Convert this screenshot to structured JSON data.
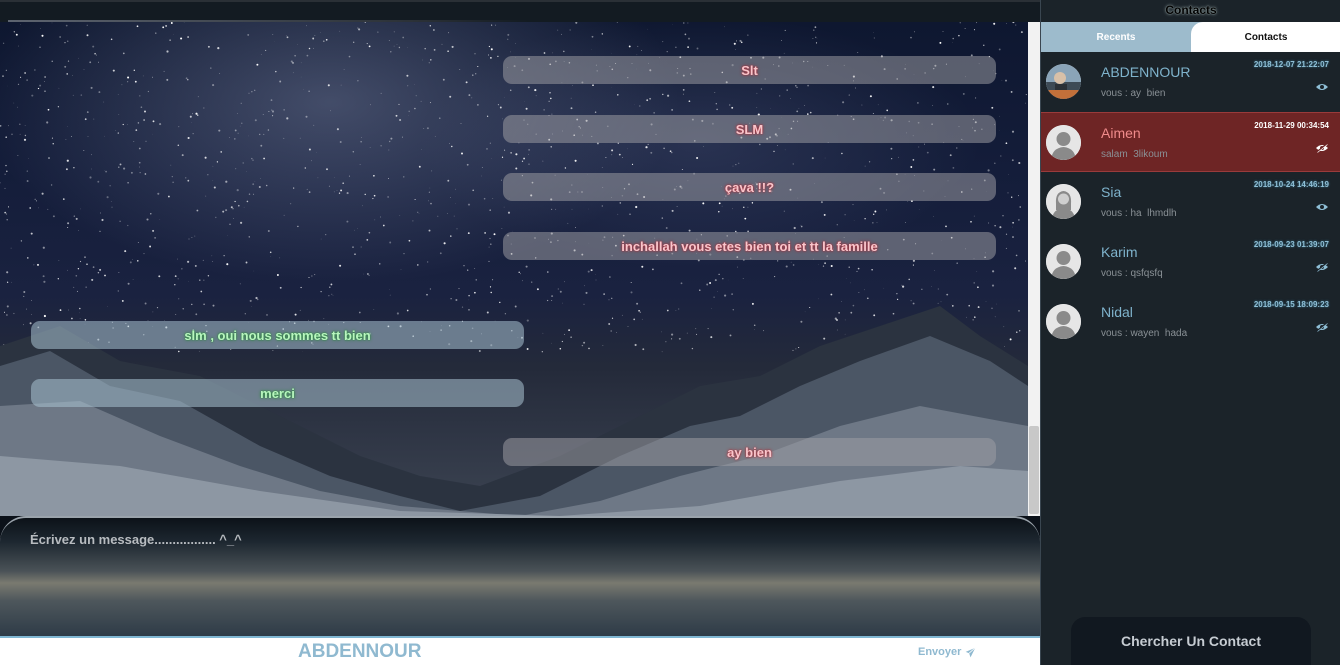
{
  "chat": {
    "messages": [
      {
        "text": "Slt",
        "direction": "sent"
      },
      {
        "text": "SLM",
        "direction": "sent"
      },
      {
        "text": "çava !!?",
        "direction": "sent"
      },
      {
        "text": "inchallah vous etes bien toi et tt la famille",
        "direction": "sent"
      },
      {
        "text": "slm , oui nous sommes tt bien",
        "direction": "received"
      },
      {
        "text": "merci",
        "direction": "received"
      },
      {
        "text": "ay bien",
        "direction": "sent"
      }
    ]
  },
  "composer": {
    "placeholder": "Écrivez un message................. ^_^"
  },
  "footer": {
    "current_contact": "ABDENNOUR",
    "send_label": "Envoyer",
    "send_icon": "paper-plane-icon"
  },
  "sidebar": {
    "title": "Contacts",
    "tabs": [
      {
        "label": "Recents"
      },
      {
        "label": "Contacts"
      }
    ],
    "active_tab": "Contacts",
    "contacts": [
      {
        "name": "ABDENNOUR",
        "preview": "vous : ay  bien",
        "date": "2018-12-07 21:22:07",
        "avatar": "photo-avatar",
        "seen": true,
        "active": false
      },
      {
        "name": "Aimen",
        "preview": "salam  3likoum",
        "date": "2018-11-29 00:34:54",
        "avatar": "default-male-avatar",
        "seen": false,
        "active": true
      },
      {
        "name": "Sia",
        "preview": "vous : ha  lhmdlh",
        "date": "2018-10-24 14:46:19",
        "avatar": "default-female-avatar",
        "seen": true,
        "active": false
      },
      {
        "name": "Karim",
        "preview": "vous : qsfqsfq",
        "date": "2018-09-23 01:39:07",
        "avatar": "default-male-avatar",
        "seen": false,
        "active": false
      },
      {
        "name": "Nidal",
        "preview": "vous : wayen  hada",
        "date": "2018-09-15 18:09:23",
        "avatar": "default-male-avatar",
        "seen": false,
        "active": false
      }
    ],
    "search_label": "Chercher Un Contact"
  },
  "colors": {
    "accent": "#8fb9d0",
    "active_contact_bg": "#6e2525",
    "sent_text": "#f7c6cc",
    "received_text": "#b9f5c0"
  }
}
